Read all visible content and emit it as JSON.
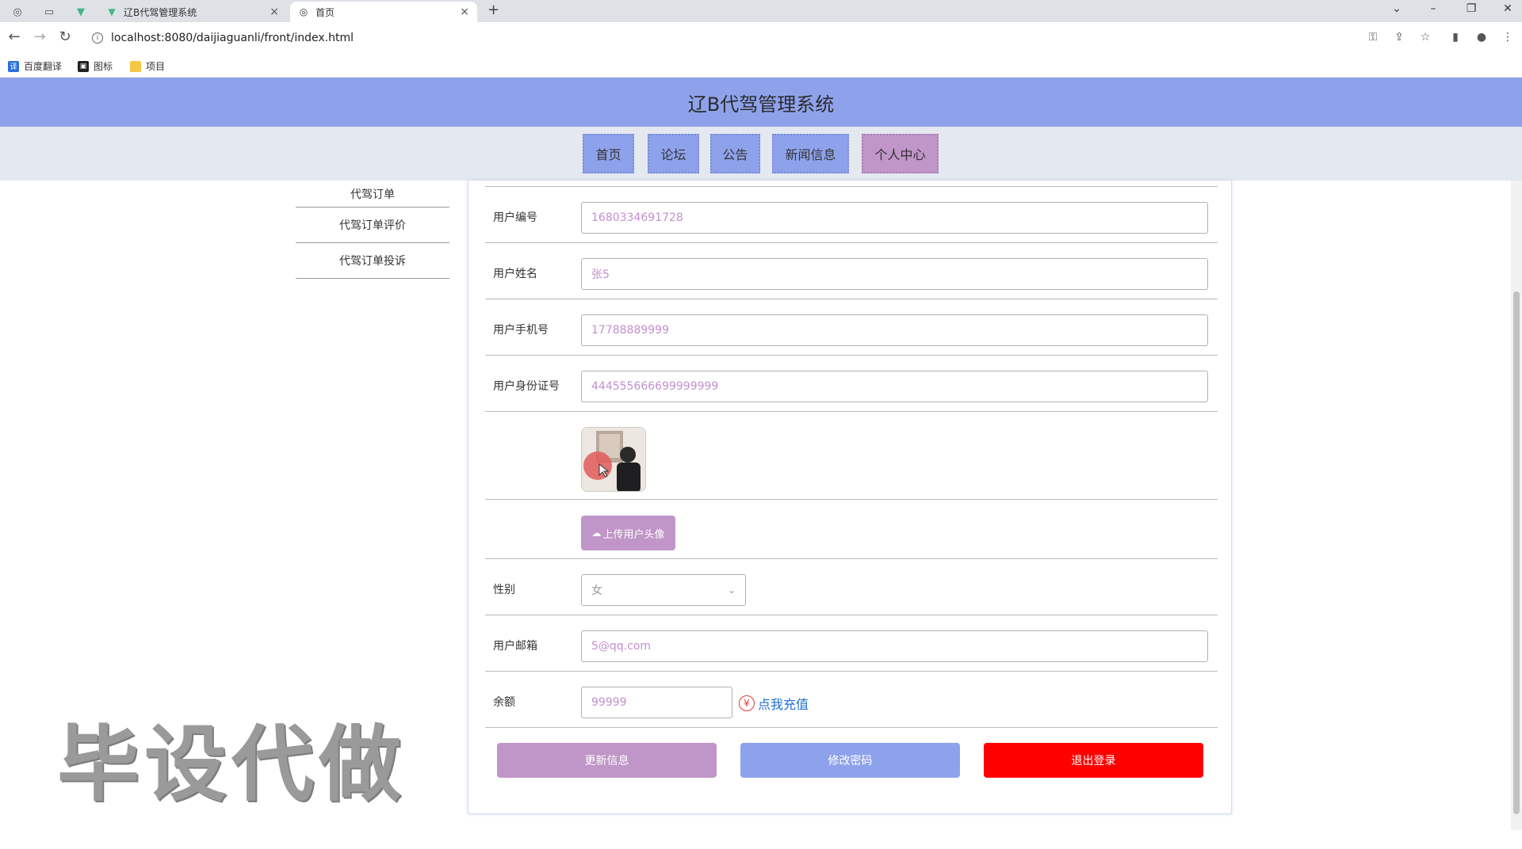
{
  "browser": {
    "tabs": [
      {
        "label": "辽B代驾管理系统",
        "icon": "vue-logo-icon"
      },
      {
        "label": "首页",
        "icon": "globe-icon"
      }
    ],
    "url": "localhost:8080/daijiaguanli/front/index.html",
    "bookmarks": [
      {
        "label": "百度翻译",
        "icon": "translate-icon"
      },
      {
        "label": "图标",
        "icon": "image-icon"
      },
      {
        "label": "项目",
        "icon": "folder-icon"
      }
    ]
  },
  "site": {
    "title": "辽B代驾管理系统",
    "nav": [
      "首页",
      "论坛",
      "公告",
      "新闻信息",
      "个人中心"
    ],
    "nav_active": "个人中心"
  },
  "sidebar": {
    "items": [
      "代驾订单",
      "代驾订单评价",
      "代驾订单投诉"
    ]
  },
  "form": {
    "user_id_label": "用户编号",
    "user_id_value": "1680334691728",
    "name_label": "用户姓名",
    "name_value": "张5",
    "phone_label": "用户手机号",
    "phone_value": "17788889999",
    "idcard_label": "用户身份证号",
    "idcard_value": "444555666699999999",
    "upload_label": "上传用户头像",
    "gender_label": "性别",
    "gender_value": "女",
    "email_label": "用户邮箱",
    "email_value": "5@qq.com",
    "balance_label": "余额",
    "balance_value": "99999",
    "recharge_label": "点我充值"
  },
  "actions": {
    "update": "更新信息",
    "change_password": "修改密码",
    "logout": "退出登录"
  },
  "colors": {
    "header": "#8ea2ec",
    "nav_active": "#c095c8",
    "update_btn": "#c095c8",
    "password_btn": "#8ea2ec",
    "logout_btn": "#ff0000"
  },
  "watermark": "毕设代做"
}
